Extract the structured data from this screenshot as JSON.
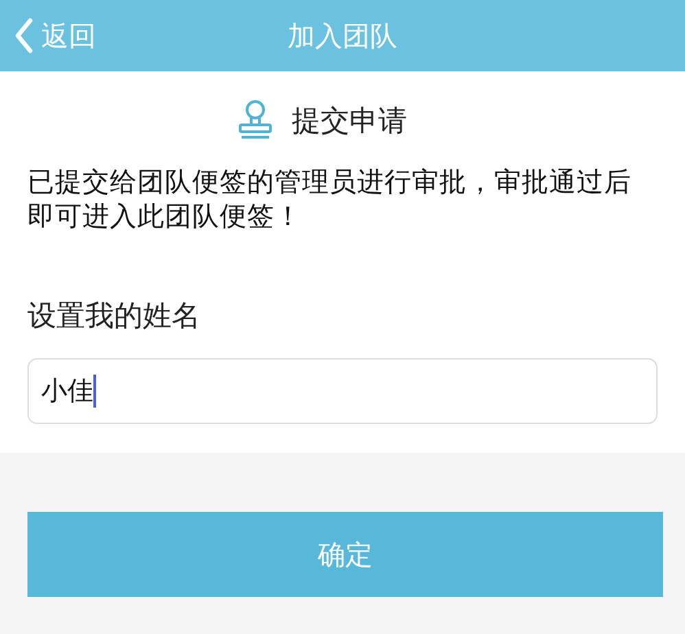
{
  "nav_bar": {
    "back": "返回",
    "title": "加入团队"
  },
  "status": {
    "title": "提交申请",
    "message": "已提交给团队便签的管理员进行审批，审批通过后即可进入此团队便签！"
  },
  "name_field": {
    "label": "设置我的姓名",
    "value": "小佳"
  },
  "buttons": [
    "确定"
  ]
}
